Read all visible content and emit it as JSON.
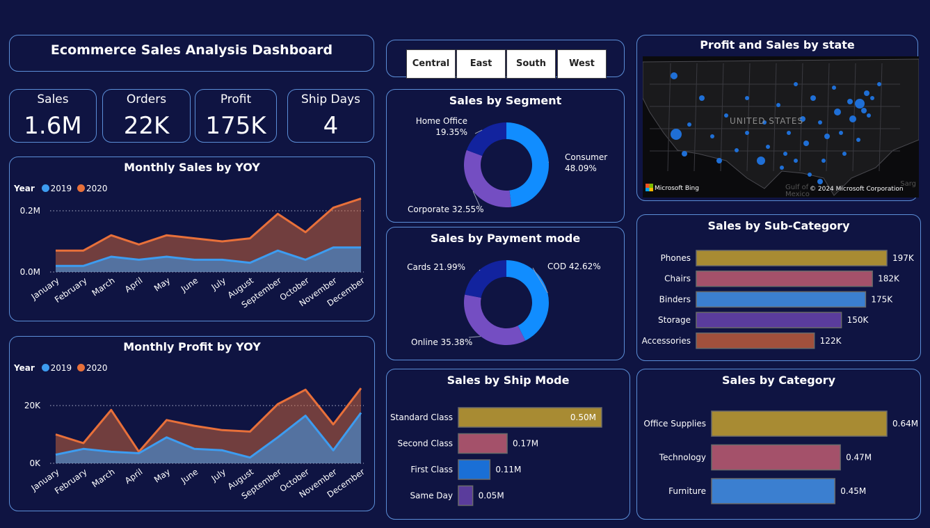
{
  "dashboard": {
    "title": "Ecommerce Sales Analysis Dashboard"
  },
  "slicer": {
    "regions": [
      "Central",
      "East",
      "South",
      "West"
    ]
  },
  "kpis": [
    {
      "label": "Sales",
      "value": "1.6M"
    },
    {
      "label": "Orders",
      "value": "22K"
    },
    {
      "label": "Profit",
      "value": "175K"
    },
    {
      "label": "Ship Days",
      "value": "4"
    }
  ],
  "colors": {
    "background": "#0f1442",
    "border": "#5c8fd8",
    "series_2019": "#3d9cf0",
    "series_2020": "#e8703a",
    "donut_a": "#118dff",
    "donut_b": "#744ec2",
    "donut_c": "#12239e"
  },
  "map": {
    "title": "Profit and Sales by state",
    "country_label": "UNITED STATES",
    "gulf_label": "Gulf of Mexico",
    "sea_label": "Sarg",
    "bing_label": "Microsoft Bing",
    "copyright": "© 2024 Microsoft Corporation"
  },
  "chart_data": [
    {
      "id": "monthly_sales",
      "type": "area",
      "title": "Monthly Sales by YOY",
      "legend_title": "Year",
      "legend_position": "top-left",
      "categories": [
        "January",
        "February",
        "March",
        "April",
        "May",
        "June",
        "July",
        "August",
        "September",
        "October",
        "November",
        "December"
      ],
      "series": [
        {
          "name": "2019",
          "color": "#3d9cf0",
          "values": [
            0.02,
            0.02,
            0.05,
            0.04,
            0.05,
            0.04,
            0.04,
            0.03,
            0.07,
            0.04,
            0.08,
            0.08
          ]
        },
        {
          "name": "2020",
          "color": "#e8703a",
          "values": [
            0.07,
            0.07,
            0.12,
            0.09,
            0.12,
            0.11,
            0.1,
            0.11,
            0.19,
            0.13,
            0.21,
            0.24
          ]
        }
      ],
      "ylim": [
        0,
        0.25
      ],
      "yticks": [
        {
          "value": 0,
          "label": "0.0M"
        },
        {
          "value": 0.2,
          "label": "0.2M"
        }
      ],
      "grid": "dotted"
    },
    {
      "id": "monthly_profit",
      "type": "area",
      "title": "Monthly Profit by YOY",
      "legend_title": "Year",
      "legend_position": "top-left",
      "categories": [
        "January",
        "February",
        "March",
        "April",
        "May",
        "June",
        "July",
        "August",
        "September",
        "October",
        "November",
        "December"
      ],
      "series": [
        {
          "name": "2019",
          "color": "#3d9cf0",
          "values": [
            3,
            5,
            4,
            3.5,
            9,
            5,
            4.5,
            2,
            9,
            16.5,
            4.5,
            17.5
          ]
        },
        {
          "name": "2020",
          "color": "#e8703a",
          "values": [
            10,
            7,
            18.5,
            4,
            15,
            13,
            11.5,
            11,
            20.5,
            25.5,
            13.5,
            26
          ]
        }
      ],
      "ylim": [
        0,
        27
      ],
      "yticks": [
        {
          "value": 0,
          "label": "0K"
        },
        {
          "value": 20,
          "label": "20K"
        }
      ],
      "grid": "dotted"
    },
    {
      "id": "segment",
      "type": "pie",
      "title": "Sales by Segment",
      "labels": [
        {
          "name": "Consumer",
          "pct": "48.09%"
        },
        {
          "name": "Corporate",
          "pct": "32.55%"
        },
        {
          "name": "Home Office",
          "pct": "19.35%"
        }
      ],
      "values": [
        48.09,
        32.55,
        19.35
      ]
    },
    {
      "id": "payment",
      "type": "pie",
      "title": "Sales by Payment mode",
      "labels": [
        {
          "name": "COD",
          "pct": "42.62%"
        },
        {
          "name": "Online",
          "pct": "35.38%"
        },
        {
          "name": "Cards",
          "pct": "21.99%"
        }
      ],
      "values": [
        42.62,
        35.38,
        21.99
      ]
    },
    {
      "id": "sub_category",
      "type": "bar",
      "title": "Sales by Sub-Category",
      "categories": [
        "Phones",
        "Chairs",
        "Binders",
        "Storage",
        "Accessories"
      ],
      "values": [
        197,
        182,
        175,
        150,
        122
      ],
      "value_labels": [
        "197K",
        "182K",
        "175K",
        "150K",
        "122K"
      ],
      "colors": [
        "#a88b33",
        "#a4516a",
        "#3b7fd0",
        "#5a3c9c",
        "#a1503c"
      ],
      "xlim": [
        0,
        197
      ]
    },
    {
      "id": "ship_mode",
      "type": "bar",
      "title": "Sales by Ship Mode",
      "categories": [
        "Standard Class",
        "Second Class",
        "First Class",
        "Same Day"
      ],
      "values": [
        0.5,
        0.17,
        0.11,
        0.05
      ],
      "value_labels": [
        "0.50M",
        "0.17M",
        "0.11M",
        "0.05M"
      ],
      "colors": [
        "#a88b33",
        "#a4516a",
        "#1a6fd6",
        "#5a3c9c"
      ],
      "xlim": [
        0,
        0.5
      ]
    },
    {
      "id": "category",
      "type": "bar",
      "title": "Sales by Category",
      "categories": [
        "Office Supplies",
        "Technology",
        "Furniture"
      ],
      "values": [
        0.64,
        0.47,
        0.45
      ],
      "value_labels": [
        "0.64M",
        "0.47M",
        "0.45M"
      ],
      "colors": [
        "#a88b33",
        "#a4516a",
        "#3b7fd0"
      ],
      "xlim": [
        0,
        0.64
      ]
    }
  ]
}
